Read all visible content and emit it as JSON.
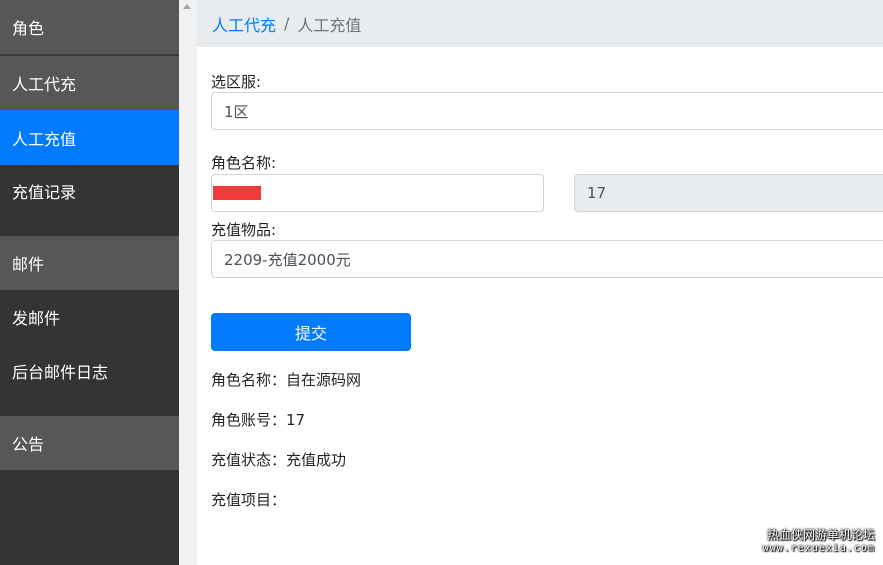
{
  "sidebar": {
    "items": [
      {
        "label": "角色"
      },
      {
        "label": "人工代充"
      },
      {
        "label": "人工充值"
      },
      {
        "label": "充值记录"
      },
      {
        "label": "邮件"
      },
      {
        "label": "发邮件"
      },
      {
        "label": "后台邮件日志"
      },
      {
        "label": "公告"
      }
    ]
  },
  "breadcrumb": {
    "parent": "人工代充",
    "separator": "/",
    "current": "人工充值"
  },
  "form": {
    "server_label": "选区服:",
    "server_value": "1区",
    "role_name_label": "角色名称:",
    "role_name_value": "",
    "role_id_value": "17",
    "item_label": "充值物品:",
    "item_value": "2209-充值2000元",
    "submit_label": "提交"
  },
  "result": {
    "role_name": "角色名称：自在源码网",
    "role_account": "角色账号：17",
    "status": "充值状态：充值成功",
    "item": "充值项目："
  },
  "watermark": {
    "line1": "热血侠网游单机论坛",
    "line2": "www.rexuexia.com"
  },
  "colors": {
    "accent": "#007bff",
    "sidebar_bg": "#343434",
    "sidebar_category_bg": "#575757",
    "redaction": "#f23a3a"
  }
}
